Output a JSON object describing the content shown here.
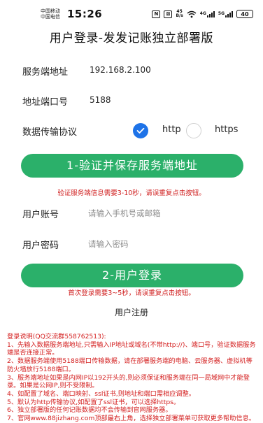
{
  "status_bar": {
    "carrier_1": "中国移动",
    "carrier_2": "中国电信",
    "time": "15:26",
    "nfc": "N",
    "vibrate": "⊠",
    "speed_value": "45",
    "speed_unit": "B/s",
    "net_1": "4G",
    "net_2": "5G",
    "battery": "40"
  },
  "page_title": "用户登录-发发记账独立部署版",
  "server": {
    "address_label": "服务端地址",
    "address_value": "192.168.2.100",
    "port_label": "地址端口号",
    "port_value": "5188",
    "protocol_label": "数据传输协议",
    "protocol_options": [
      "http",
      "https"
    ],
    "protocol_selected": "http"
  },
  "verify_button": "1-验证并保存服务端地址",
  "verify_hint": "验证服务端信息需要3-10秒，请误重复点击按钮。",
  "account": {
    "label": "用户账号",
    "placeholder": "请输入手机号或邮箱"
  },
  "password": {
    "label": "用户密码",
    "placeholder": "请输入密码"
  },
  "login_button": "2-用户登录",
  "login_hint": "首次登录需要3~5秒，请误重复点击按钮。",
  "register_link": "用户注册",
  "notes": [
    "登录说明(QQ交流群558762513):",
    "1、先输入数据服务端地址,只需输入IP地址或域名(不带http://)、端口号，验证数据服务端是否连接正常。",
    "2、数据服务端使用5188端口传输数据，请在部署服务端的电脑、云服务器、虚拟机等防火墙放行5188端口。",
    "3、服务端地址如果是内网IP以192开头的,则必须保证和服务端在同一局域网中才能登录。如果是公网IP,则不受限制。",
    "4、如配置了域名、端口映射、ssl证书,则地址和端口需相应调整。",
    "5、默认为http传输协议,如配置了ssl证书，可以选择https。",
    "6、独立部署版的任何记账数据均不会传输到官网服务器。",
    "7、官网www.88jizhang.com顶部最右上角，选择独立部署菜单可获取更多帮助信息。"
  ],
  "colors": {
    "accent_green": "#2bb06a",
    "radio_blue": "#1e73e8",
    "warning_red": "#d02020"
  }
}
